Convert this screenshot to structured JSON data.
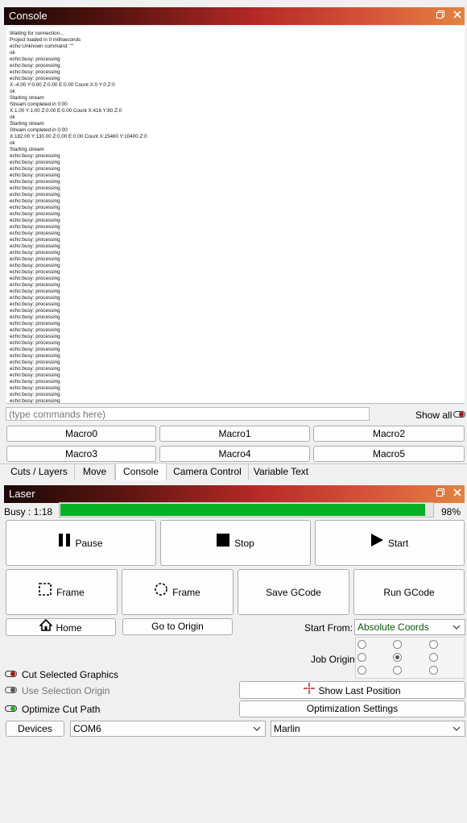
{
  "console_panel": {
    "title": "Console",
    "lines": [
      "Waiting for connection...",
      "Project loaded in 0 milliseconds",
      "echo:Unknown command: \"\"",
      "ok",
      "echo:busy: processing",
      "echo:busy: processing",
      "echo:busy: processing",
      "echo:busy: processing",
      "X:-4.00 Y:0.00 Z:0.00 E:0.00 Count X:0 Y:0 Z:0",
      "ok",
      "Starting stream",
      "Stream completed in 0:00",
      "X:1.00 Y:1.00 Z:0.00 E:0.00 Count X:416 Y:80 Z:0",
      "ok",
      "Starting stream",
      "Stream completed in 0:00",
      "X:182.00 Y:130.00 Z:0.00 E:0.00 Count X:15460 Y:10400 Z:0",
      "ok",
      "Starting stream",
      "echo:busy: processing",
      "echo:busy: processing",
      "echo:busy: processing",
      "echo:busy: processing",
      "echo:busy: processing",
      "echo:busy: processing",
      "echo:busy: processing",
      "echo:busy: processing",
      "echo:busy: processing",
      "echo:busy: processing",
      "echo:busy: processing",
      "echo:busy: processing",
      "echo:busy: processing",
      "echo:busy: processing",
      "echo:busy: processing",
      "echo:busy: processing",
      "echo:busy: processing",
      "echo:busy: processing",
      "echo:busy: processing",
      "echo:busy: processing",
      "echo:busy: processing",
      "echo:busy: processing",
      "echo:busy: processing",
      "echo:busy: processing",
      "echo:busy: processing",
      "echo:busy: processing",
      "echo:busy: processing",
      "echo:busy: processing",
      "echo:busy: processing",
      "echo:busy: processing",
      "echo:busy: processing",
      "echo:busy: processing",
      "echo:busy: processing",
      "echo:busy: processing",
      "echo:busy: processing",
      "echo:busy: processing",
      "echo:busy: processing",
      "echo:busy: processing",
      "echo:busy: processing",
      "echo:busy: processing"
    ],
    "command_placeholder": "(type commands here)",
    "show_all_label": "Show all",
    "macros": [
      "Macro0",
      "Macro1",
      "Macro2",
      "Macro3",
      "Macro4",
      "Macro5"
    ]
  },
  "tabs": [
    "Cuts / Layers",
    "Move",
    "Console",
    "Camera Control",
    "Variable Text"
  ],
  "laser_panel": {
    "title": "Laser",
    "status_label": "Busy : 1:18",
    "progress_percent": 98,
    "progress_text": "98%",
    "pause_label": "Pause",
    "stop_label": "Stop",
    "start_label": "Start",
    "frame_rect_label": "Frame",
    "frame_circle_label": "Frame",
    "save_gcode_label": "Save GCode",
    "run_gcode_label": "Run GCode",
    "home_label": "Home",
    "go_to_origin_label": "Go to Origin",
    "start_from_label": "Start From:",
    "start_from_value": "Absolute Coords",
    "job_origin_label": "Job Origin",
    "job_origin_selected": "center",
    "cut_selected_label": "Cut Selected Graphics",
    "use_selection_origin_label": "Use Selection Origin",
    "optimize_cut_path_label": "Optimize Cut Path",
    "show_last_position_label": "Show Last Position",
    "optimization_settings_label": "Optimization Settings",
    "devices_label": "Devices",
    "port_value": "COM6",
    "controller_value": "Marlin"
  },
  "colors": {
    "progress_fill": "#06b025",
    "toggle_off_knob": "#a01818",
    "toggle_on_knob": "#20b020",
    "start_from_text": "#0a5a0a"
  },
  "window_buttons": {
    "restore_icon": "restore-icon",
    "close_icon": "close-icon"
  }
}
